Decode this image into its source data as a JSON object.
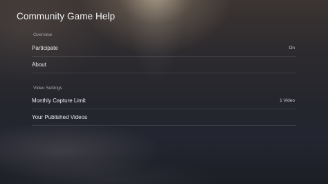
{
  "page": {
    "title": "Community Game Help"
  },
  "sections": [
    {
      "label": "Overview",
      "rows": [
        {
          "label": "Participate",
          "value": "On"
        },
        {
          "label": "About",
          "value": ""
        }
      ]
    },
    {
      "label": "Video Settings",
      "rows": [
        {
          "label": "Monthly Capture Limit",
          "value": "1 Video"
        },
        {
          "label": "Your Published Videos",
          "value": ""
        }
      ]
    }
  ]
}
